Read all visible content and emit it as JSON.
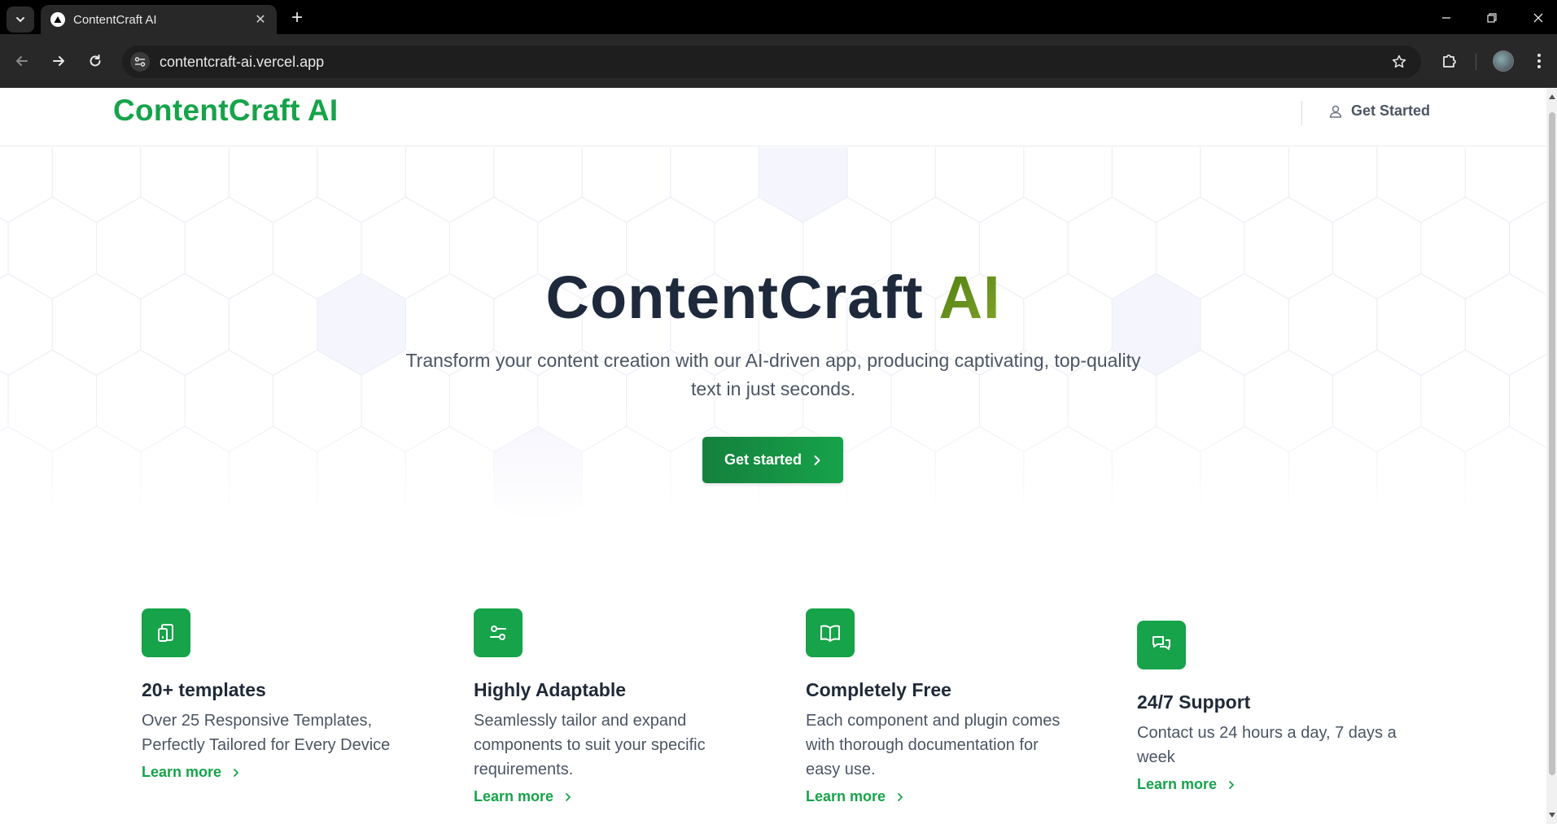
{
  "browser": {
    "tab_title": "ContentCraft AI",
    "url": "contentcraft-ai.vercel.app"
  },
  "header": {
    "logo": "ContentCraft AI",
    "cta_label": "Get Started"
  },
  "hero": {
    "title_main": "ContentCraft",
    "title_accent": "AI",
    "subtitle": "Transform your content creation with our AI-driven app, producing captivating, top-quality text in just seconds.",
    "button_label": "Get started"
  },
  "features": [
    {
      "icon": "tablet-icon",
      "title": "20+ templates",
      "description": "Over 25 Responsive Templates, Perfectly Tailored for Every Device",
      "link": "Learn more"
    },
    {
      "icon": "sliders-icon",
      "title": "Highly Adaptable",
      "description": "Seamlessly tailor and expand components to suit your specific requirements.",
      "link": "Learn more"
    },
    {
      "icon": "book-open-icon",
      "title": "Completely Free",
      "description": "Each component and plugin comes with thorough documentation for easy use.",
      "link": "Learn more"
    },
    {
      "icon": "chat-bubbles-icon",
      "title": "24/7 Support",
      "description": "Contact us 24 hours a day, 7 days a week",
      "link": "Learn more"
    }
  ],
  "colors": {
    "brand_green": "#16a34a",
    "accent_olive": "#65a30d",
    "heading": "#1e293b"
  }
}
